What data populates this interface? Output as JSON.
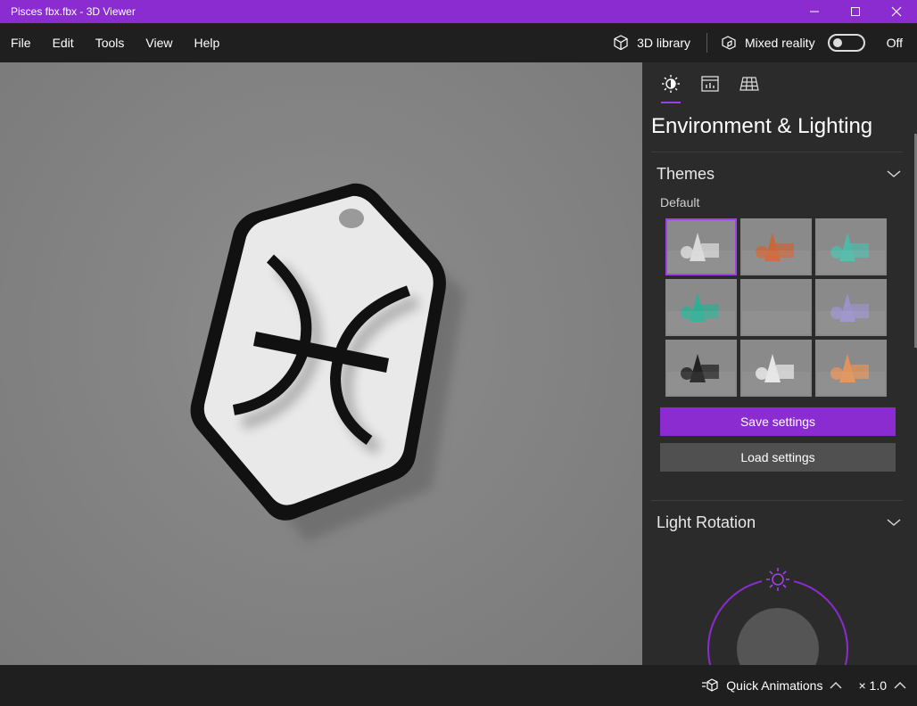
{
  "window": {
    "title": "Pisces fbx.fbx - 3D Viewer"
  },
  "menu": [
    "File",
    "Edit",
    "Tools",
    "View",
    "Help"
  ],
  "toolbar": {
    "library_label": "3D library",
    "mixed_reality_label": "Mixed reality",
    "mixed_reality_state": "Off"
  },
  "panel": {
    "title": "Environment & Lighting",
    "tabs": [
      "lighting-tab",
      "stats-tab",
      "grid-tab"
    ],
    "themes": {
      "heading": "Themes",
      "sub_label": "Default",
      "selected_index": 0,
      "colors": [
        "#d9d9d9",
        "#c9663a",
        "#4fb8a8",
        "#2fae93",
        "#8a8a8a",
        "#9b92c9",
        "#222222",
        "#e6e6e6",
        "#e0935a"
      ]
    },
    "save_label": "Save settings",
    "load_label": "Load settings",
    "light_rotation": {
      "heading": "Light Rotation"
    }
  },
  "status": {
    "quick_animations_label": "Quick Animations",
    "speed": "× 1.0"
  },
  "colors": {
    "accent": "#8a2cd0",
    "panel": "#2b2b2b",
    "bar": "#1f1f1f"
  }
}
